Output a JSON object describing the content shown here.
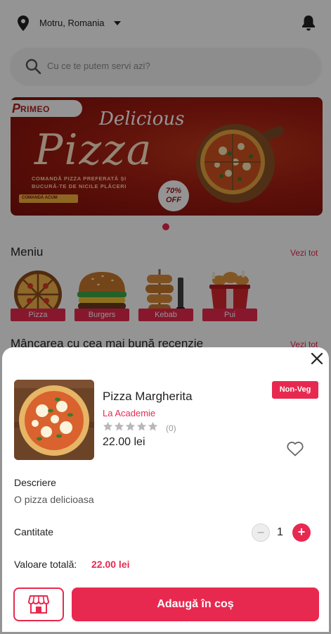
{
  "header": {
    "location": "Motru, Romania",
    "location_icon": "location-pin-icon",
    "dropdown_icon": "caret-down-icon",
    "notifications_icon": "bell-icon"
  },
  "search": {
    "placeholder": "Cu ce te putem servi azi?",
    "icon": "search-icon"
  },
  "banner": {
    "brand": "RIMEO",
    "headline_top": "Delicious",
    "headline_main": "Pizza",
    "tagline_1": "COMANDĂ PIZZA PREFERATĂ ȘI",
    "tagline_2": "BUCURĂ-TE DE NICILE PLĂCERI",
    "cta": "COMANDĂ ACUM",
    "discount_1": "70%",
    "discount_2": "OFF",
    "carousel_active_index": 0
  },
  "menu": {
    "title": "Meniu",
    "see_all": "Vezi tot",
    "categories": [
      {
        "label": "Pizza",
        "icon": "pizza-icon"
      },
      {
        "label": "Burgers",
        "icon": "burger-icon"
      },
      {
        "label": "Kebab",
        "icon": "kebab-icon"
      },
      {
        "label": "Pui",
        "icon": "chicken-bucket-icon"
      }
    ]
  },
  "top_rated": {
    "title": "Mâncarea cu cea mai bună recenzie",
    "see_all": "Vezi tot"
  },
  "sheet": {
    "close_icon": "close-icon",
    "product": {
      "name": "Pizza Margherita",
      "restaurant": "La Academie",
      "rating_stars": 0,
      "rating_count": "(0)",
      "price": "22.00 lei",
      "badge": "Non-Veg",
      "favorite_icon": "heart-outline-icon"
    },
    "description_label": "Descriere",
    "description": "O pizza delicioasa",
    "quantity_label": "Cantitate",
    "quantity": "1",
    "minus_symbol": "−",
    "plus_symbol": "+",
    "total_label": "Valoare totală:",
    "total_value": "22.00 lei",
    "store_icon": "store-icon",
    "add_to_cart": "Adaugă în coș"
  },
  "colors": {
    "accent": "#e8294f",
    "overlay": "rgba(0,0,0,0.42)"
  }
}
